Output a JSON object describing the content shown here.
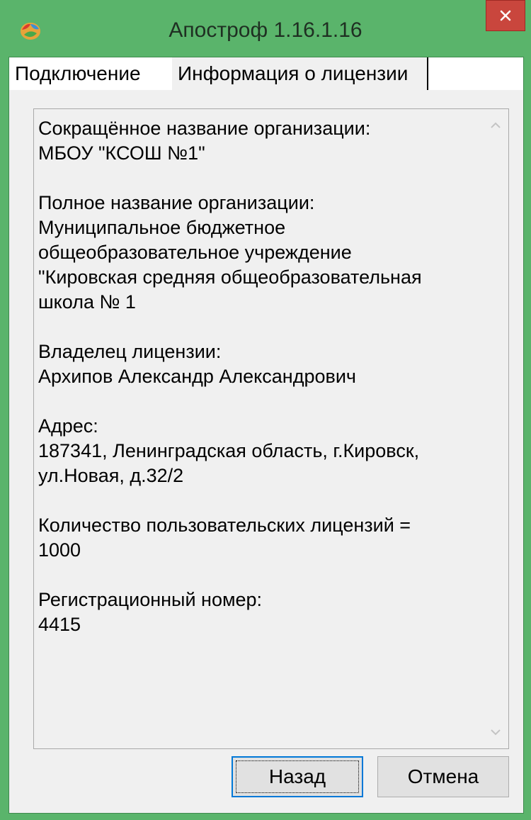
{
  "window": {
    "title": "Апостроф 1.16.1.16"
  },
  "tabs": [
    {
      "label": "Подключение"
    },
    {
      "label": "Информация о лицензии"
    }
  ],
  "license_info": {
    "short_name_label": "Сокращённое название организации:",
    "short_name_value": "МБОУ \"КСОШ №1\"",
    "full_name_label": "Полное название организации:",
    "full_name_line1": "Муниципальное бюджетное",
    "full_name_line2": "общеобразовательное учреждение",
    "full_name_line3": "\"Кировская средняя общеобразовательная",
    "full_name_line4": "школа № 1",
    "owner_label": "Владелец лицензии:",
    "owner_value": "Архипов Александр Александрович",
    "address_label": "Адрес:",
    "address_line1": "187341, Ленинградская область, г.Кировск,",
    "address_line2": "ул.Новая, д.32/2",
    "licenses_label": "Количество пользовательских лицензий =",
    "licenses_value": "1000",
    "regnum_label": "Регистрационный номер:",
    "regnum_value": "4415"
  },
  "buttons": {
    "back_label": "Назад",
    "cancel_label": "Отмена"
  }
}
